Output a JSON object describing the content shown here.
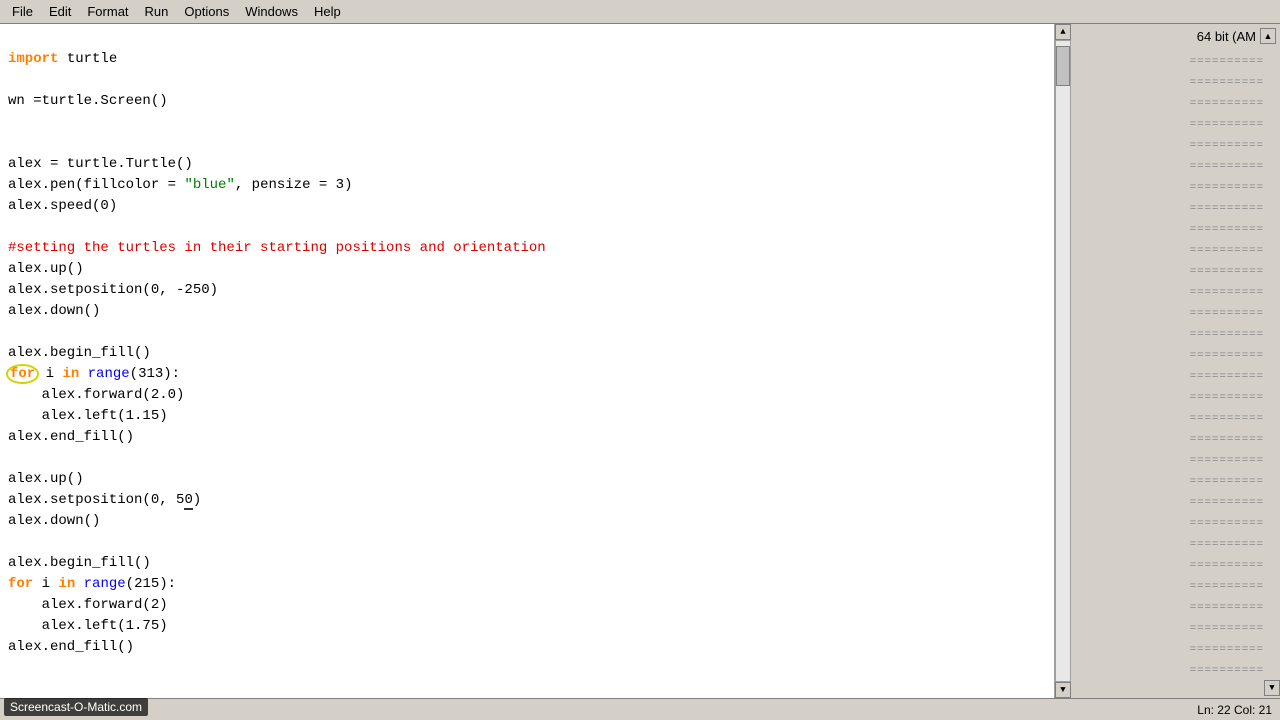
{
  "menu": {
    "items": [
      "File",
      "Edit",
      "Format",
      "Run",
      "Options",
      "Windows",
      "Help"
    ]
  },
  "right_panel": {
    "bit_info": "64 bit (AM"
  },
  "status_bar": {
    "position": "Ln: 22  Col: 21"
  },
  "watermark": "Screencast-O-Matic.com",
  "code": {
    "lines": [
      {
        "type": "import",
        "text": "import turtle"
      },
      {
        "type": "blank"
      },
      {
        "type": "normal",
        "text": "wn =turtle.Screen()"
      },
      {
        "type": "blank"
      },
      {
        "type": "blank"
      },
      {
        "type": "normal",
        "text": "alex = turtle.Turtle()"
      },
      {
        "type": "normal",
        "text": "alex.pen(fillcolor = \"blue\", pensize = 3)"
      },
      {
        "type": "normal",
        "text": "alex.speed(0)"
      },
      {
        "type": "blank"
      },
      {
        "type": "comment",
        "text": "#setting the turtles in their starting positions and orientation"
      },
      {
        "type": "normal",
        "text": "alex.up()"
      },
      {
        "type": "normal",
        "text": "alex.setposition(0, -250)"
      },
      {
        "type": "normal",
        "text": "alex.down()"
      },
      {
        "type": "blank"
      },
      {
        "type": "normal",
        "text": "alex.begin_fill()"
      },
      {
        "type": "for",
        "text": "for i in range(313):"
      },
      {
        "type": "indent",
        "text": "    alex.forward(2.0)"
      },
      {
        "type": "indent",
        "text": "    alex.left(1.15)"
      },
      {
        "type": "normal",
        "text": "alex.end_fill()"
      },
      {
        "type": "blank"
      },
      {
        "type": "normal",
        "text": "alex.up()"
      },
      {
        "type": "normal",
        "text": "alex.setposition(0, 50)"
      },
      {
        "type": "normal",
        "text": "alex.down()"
      },
      {
        "type": "blank"
      },
      {
        "type": "normal",
        "text": "alex.begin_fill()"
      },
      {
        "type": "for2",
        "text": "for i in range(215):"
      },
      {
        "type": "indent",
        "text": "    alex.forward(2)"
      },
      {
        "type": "indent",
        "text": "    alex.left(1.75)"
      },
      {
        "type": "normal",
        "text": "alex.end_fill()"
      }
    ]
  },
  "decorations": {
    "count": 30
  }
}
